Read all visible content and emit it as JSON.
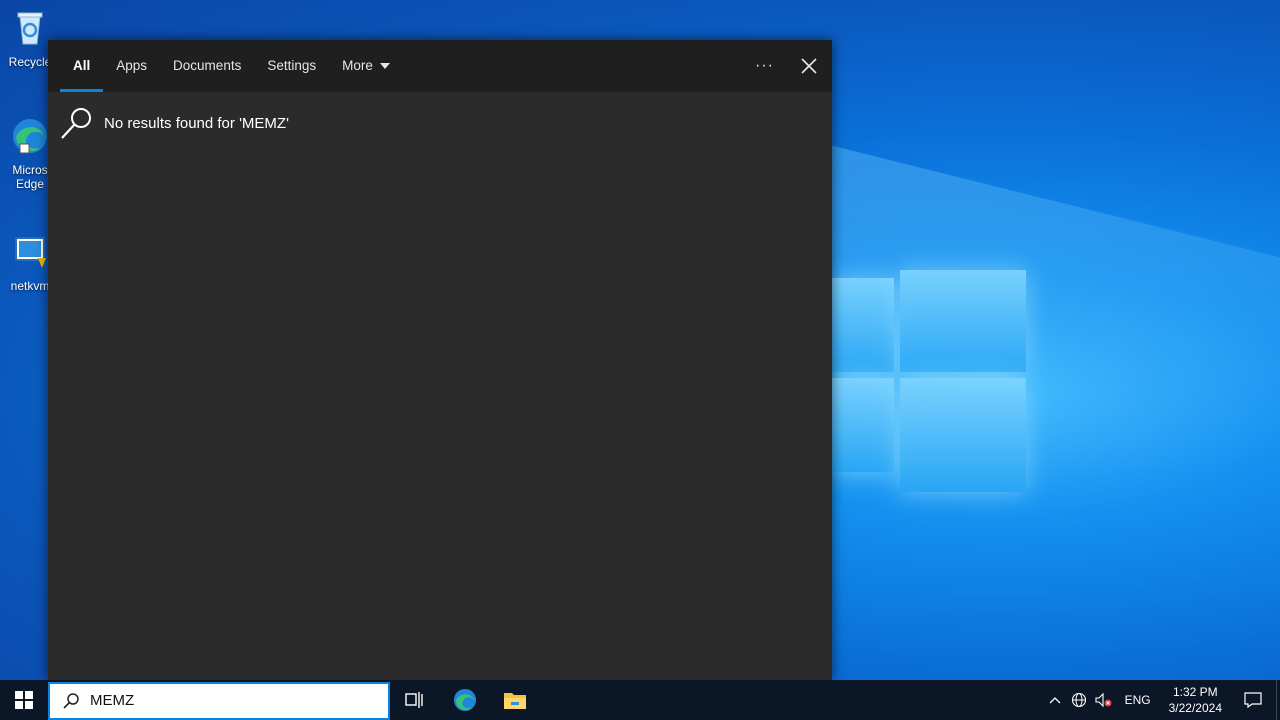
{
  "desktop": {
    "icons": [
      {
        "label": "Recycle",
        "icon": "recycle-bin-icon"
      },
      {
        "label": "Micros Edge",
        "icon": "edge-icon"
      },
      {
        "label": "netkvm",
        "icon": "installer-icon"
      }
    ]
  },
  "search_flyout": {
    "tabs": [
      {
        "label": "All",
        "active": true
      },
      {
        "label": "Apps"
      },
      {
        "label": "Documents"
      },
      {
        "label": "Settings"
      },
      {
        "label": "More"
      }
    ],
    "options_label": "···",
    "no_results_text": "No results found for 'MEMZ'"
  },
  "taskbar": {
    "search_value": "MEMZ",
    "pinned": [
      "task-view-icon",
      "edge-icon",
      "file-explorer-icon"
    ],
    "tray": {
      "language": "ENG",
      "time": "1:32 PM",
      "date": "3/22/2024"
    }
  },
  "colors": {
    "accent": "#0a84e0",
    "flyout_bg": "#2b2b2b",
    "tabs_bg": "#1f1f1f",
    "taskbar_bg": "#0b1626"
  }
}
